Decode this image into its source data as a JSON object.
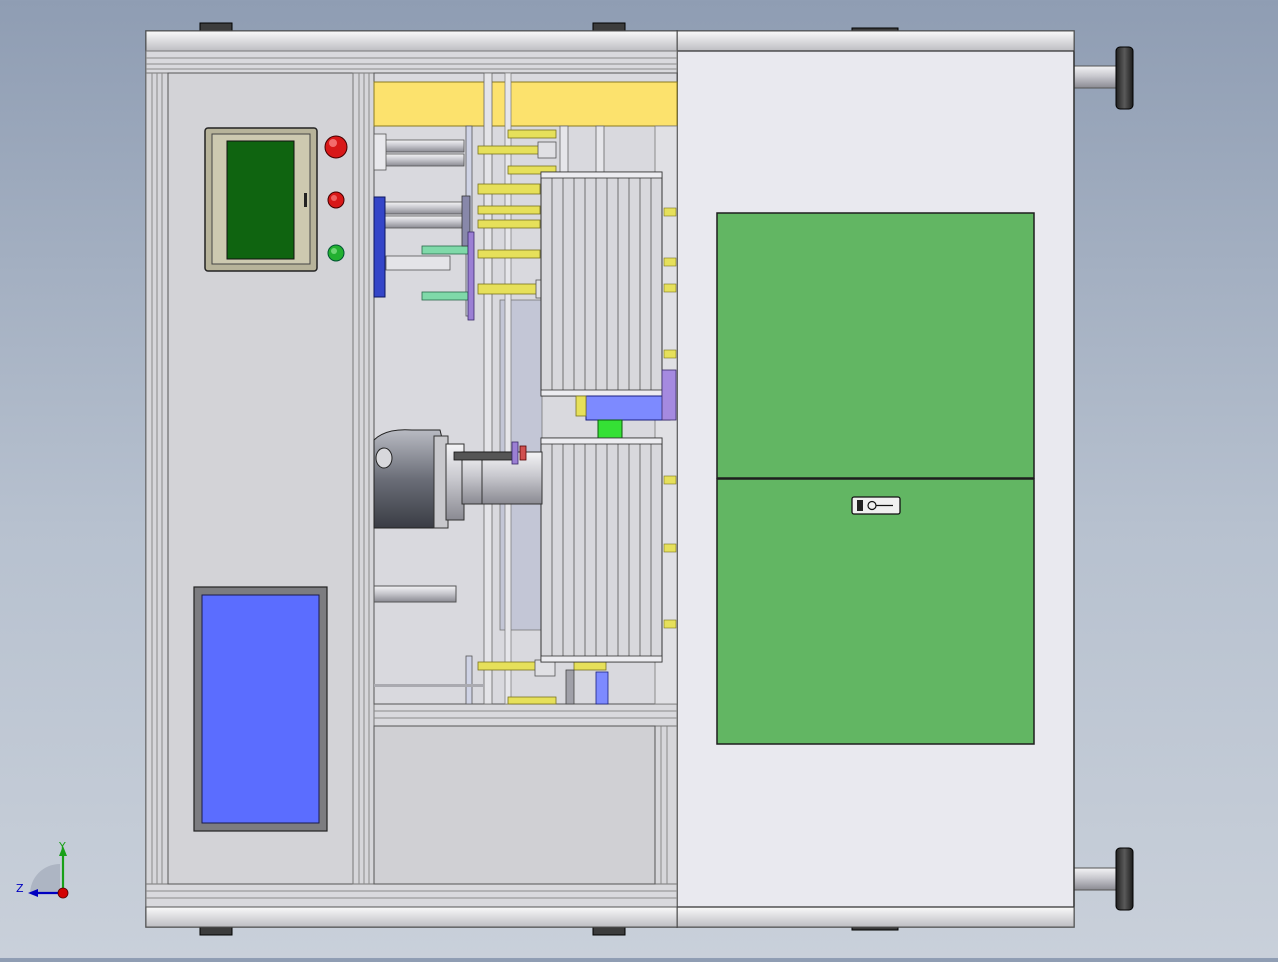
{
  "scene": {
    "type": "cad-assembly-front-view",
    "background_top": "#8f9db3",
    "background_bottom": "#c9d0da"
  },
  "colors": {
    "frame": "#d4d4d7",
    "frame_edge": "#4a4a4a",
    "right_cabinet": "#e9e9ef",
    "door_panel": "#62b663",
    "hmi_screen": "#0f6410",
    "hmi_bezel": "#b7b39a",
    "electrical_window": "#5b6dff",
    "yellow_beam": "#fce26d",
    "yellow_pin": "#e6e05a",
    "blue_part": "#7d8aff",
    "green_part": "#35e035",
    "motor": "#6a6d78",
    "button_red": "#d81818",
    "button_green": "#22b030"
  },
  "control_panel": {
    "buttons": [
      {
        "name": "emergency-stop",
        "color": "red"
      },
      {
        "name": "stop",
        "color": "red"
      },
      {
        "name": "start",
        "color": "green"
      }
    ]
  },
  "triad": {
    "x_color": "#d20000",
    "y_color": "#18a018",
    "z_color": "#0000c0",
    "labels": {
      "y": "Y",
      "z": "Z"
    }
  }
}
